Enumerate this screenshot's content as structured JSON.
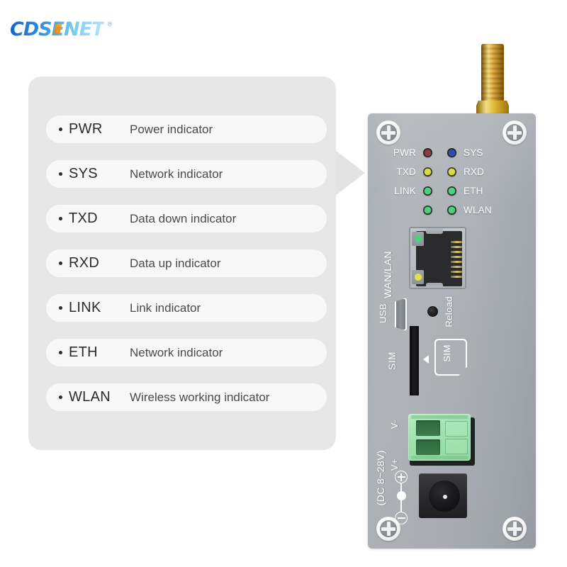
{
  "brand": {
    "name": "CDSENET",
    "trademark": "®",
    "accent_blue": "#1565c8",
    "accent_cyan": "#86d2f2",
    "accent_orange": "#e8841a"
  },
  "legend": {
    "panel_bg": "#e7e7e7",
    "row_bg": "#f8f8f8",
    "bullet": "•",
    "rows": [
      {
        "abbr": "PWR",
        "desc": "Power indicator"
      },
      {
        "abbr": "SYS",
        "desc": "Network indicator"
      },
      {
        "abbr": "TXD",
        "desc": "Data down indicator"
      },
      {
        "abbr": "RXD",
        "desc": "Data up indicator"
      },
      {
        "abbr": "LINK",
        "desc": "Link indicator"
      },
      {
        "abbr": "ETH",
        "desc": "Network indicator"
      },
      {
        "abbr": "WLAN",
        "desc": "Wireless working indicator"
      }
    ]
  },
  "device": {
    "body_color": "#aeb2b8",
    "leds": {
      "rows": [
        {
          "left_label": "PWR",
          "left_led_color": "#8c3b3f",
          "right_led_color": "#2f4fa8",
          "right_label": "SYS"
        },
        {
          "left_label": "TXD",
          "left_led_color": "#d9d94a",
          "right_led_color": "#d9d94a",
          "right_label": "RXD"
        },
        {
          "left_label": "LINK",
          "left_led_color": "#4fd07c",
          "right_led_color": "#4fd07c",
          "right_label": "ETH"
        },
        {
          "left_label": "",
          "left_led_color": "#4fd07c",
          "right_led_color": "#4fd07c",
          "right_label": "WLAN"
        }
      ]
    },
    "rj45": {
      "label": "WAN/LAN",
      "link_led_color": "#4fd07c",
      "act_led_color": "#e4e04a",
      "pin_count": 8
    },
    "usb": {
      "label": "USB"
    },
    "reload": {
      "label": "Reload"
    },
    "sim": {
      "label": "SIM",
      "card_icon_label": "SIM",
      "arrow": "◀"
    },
    "power": {
      "v_minus_label": "V-",
      "v_plus_label": "V+",
      "voltage_label": "(DC 8~28V)",
      "terminal_color": "#9fe3ae",
      "polarity_plus": "+",
      "polarity_minus": "−"
    },
    "screws": {
      "count": 4,
      "type": "phillips"
    },
    "antenna": {
      "type": "sma-connector",
      "color": "#dcb52f"
    }
  }
}
